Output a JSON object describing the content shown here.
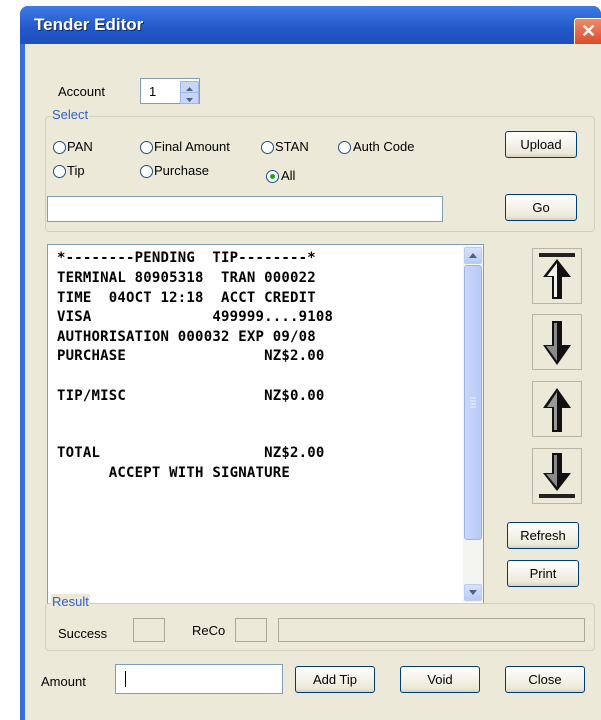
{
  "window": {
    "title": "Tender Editor",
    "close_glyph": "✕"
  },
  "account": {
    "label": "Account",
    "value": "1"
  },
  "select_group": {
    "legend": "Select",
    "radios": [
      {
        "label": "PAN",
        "selected": false
      },
      {
        "label": "Final Amount",
        "selected": false
      },
      {
        "label": "STAN",
        "selected": false
      },
      {
        "label": "Auth Code",
        "selected": false
      },
      {
        "label": "Tip",
        "selected": false
      },
      {
        "label": "Purchase",
        "selected": false
      },
      {
        "label": "All",
        "selected": true
      }
    ],
    "search_value": ""
  },
  "buttons": {
    "upload": "Upload",
    "go": "Go",
    "refresh": "Refresh",
    "print": "Print",
    "add_tip": "Add Tip",
    "void": "Void",
    "close": "Close"
  },
  "receipt": {
    "lines": [
      "*--------PENDING  TIP--------*",
      "TERMINAL 80905318  TRAN 000022",
      "TIME  04OCT 12:18  ACCT CREDIT",
      "VISA              499999....9108",
      "AUTHORISATION 000032 EXP 09/08",
      "PURCHASE                NZ$2.00",
      "",
      "TIP/MISC                NZ$0.00",
      "",
      "TOTAL                   NZ$2.00",
      "      ACCEPT WITH SIGNATURE"
    ]
  },
  "nav_icons": [
    "move-to-top-icon",
    "move-down-icon",
    "move-up-icon",
    "move-to-bottom-icon"
  ],
  "result_group": {
    "legend": "Result",
    "success_label": "Success",
    "success_value": "",
    "reco_label": "ReCo",
    "reco_value": "",
    "message_value": ""
  },
  "amount": {
    "label": "Amount",
    "value": ""
  },
  "colors": {
    "title_bar": "#2357c9",
    "window_face": "#ece9d8",
    "legend_text": "#2e5fcd",
    "close_button": "#d9482a"
  }
}
